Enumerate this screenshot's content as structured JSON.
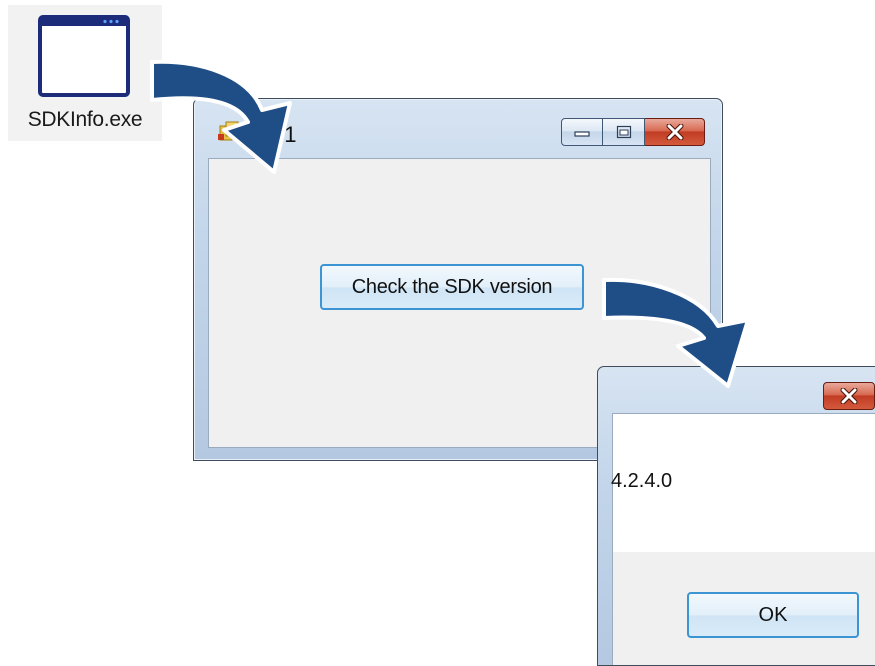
{
  "desktop": {
    "icon_name": "application-window-icon",
    "file_label": "SDKInfo.exe"
  },
  "main_window": {
    "title": "Form1",
    "title_visible_fragment": "n1",
    "caption_buttons": [
      "minimize",
      "maximize",
      "close"
    ],
    "check_button_label": "Check the SDK version"
  },
  "message_box": {
    "message": "4.2.4.0",
    "ok_label": "OK"
  },
  "colors": {
    "arrow": "#1f4e87",
    "accent_border": "#3c94d3",
    "close_red": "#c13c24"
  }
}
